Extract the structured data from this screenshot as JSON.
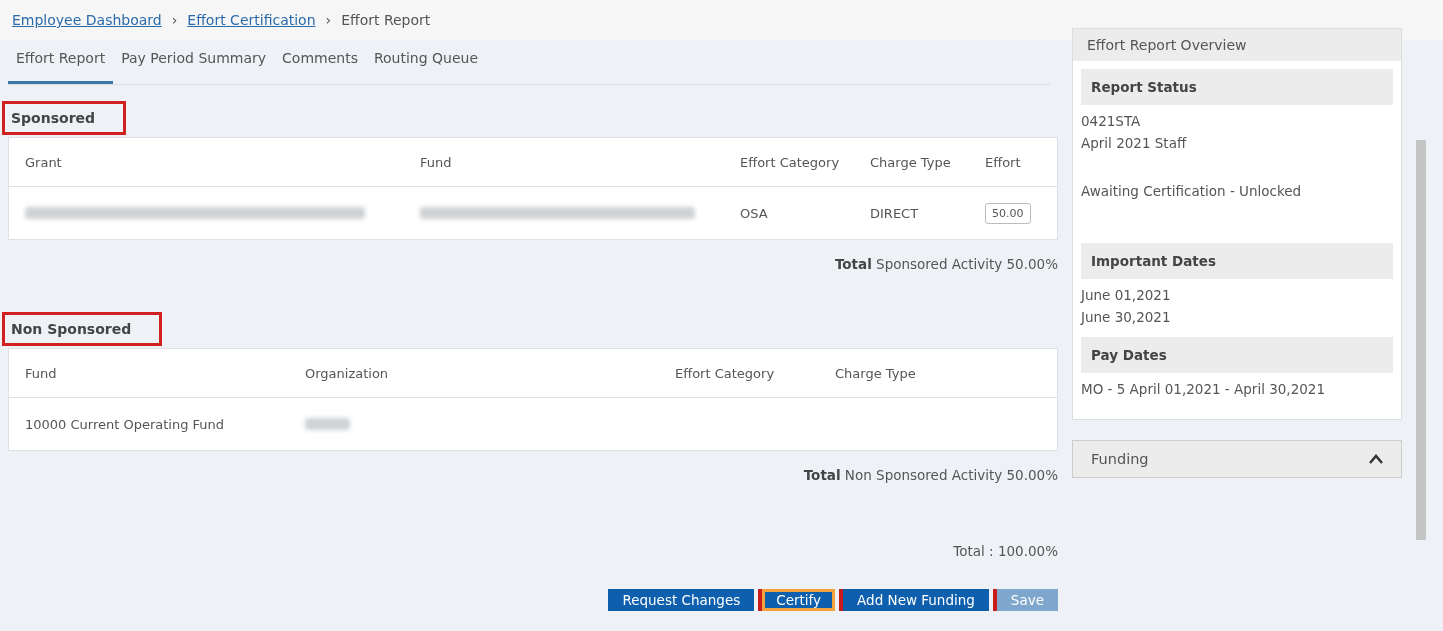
{
  "breadcrumb_separator": "›",
  "breadcrumbs": [
    {
      "label": "Employee Dashboard",
      "link": true
    },
    {
      "label": "Effort Certification",
      "link": true
    },
    {
      "label": "Effort Report",
      "link": false
    }
  ],
  "tabs": [
    {
      "label": "Effort Report",
      "selected": true
    },
    {
      "label": "Pay Period Summary",
      "selected": false
    },
    {
      "label": "Comments",
      "selected": false
    },
    {
      "label": "Routing Queue",
      "selected": false
    }
  ],
  "sponsored": {
    "title": "Sponsored",
    "columns": [
      "Grant",
      "Fund",
      "Effort Category",
      "Charge Type",
      "Effort"
    ],
    "rows": [
      {
        "grant_blurred": true,
        "fund_blurred": true,
        "effort_category": "OSA",
        "charge_type": "DIRECT",
        "effort": "50.00"
      }
    ],
    "total_label": "Total",
    "total_text": "Sponsored Activity 50.00%"
  },
  "non_sponsored": {
    "title": "Non Sponsored",
    "columns": [
      "Fund",
      "Organization",
      "Effort Category",
      "Charge Type"
    ],
    "rows": [
      {
        "fund": "10000 Current Operating Fund",
        "organization_blurred": true
      }
    ],
    "total_label": "Total",
    "total_text": "Non Sponsored Activity 50.00%"
  },
  "grand_total": "Total : 100.00%",
  "buttons": [
    {
      "label": "Request Changes",
      "disabled": false,
      "highlighted": false
    },
    {
      "label": "Certify",
      "disabled": false,
      "highlighted": true
    },
    {
      "label": "Add New Funding",
      "disabled": false,
      "highlighted": false
    },
    {
      "label": "Save",
      "disabled": true,
      "highlighted": false
    }
  ],
  "overview": {
    "title": "Effort Report Overview",
    "sections": [
      {
        "heading": "Report Status",
        "lines": [
          "0421STA",
          "April 2021 Staff",
          "Awaiting Certification - Unlocked"
        ]
      },
      {
        "heading": "Important Dates",
        "lines": [
          "June 01,2021",
          "June 30,2021"
        ]
      },
      {
        "heading": "Pay Dates",
        "lines": [
          "MO - 5 April 01,2021 - April 30,2021"
        ]
      }
    ]
  },
  "funding": {
    "title": "Funding",
    "expanded": true
  }
}
